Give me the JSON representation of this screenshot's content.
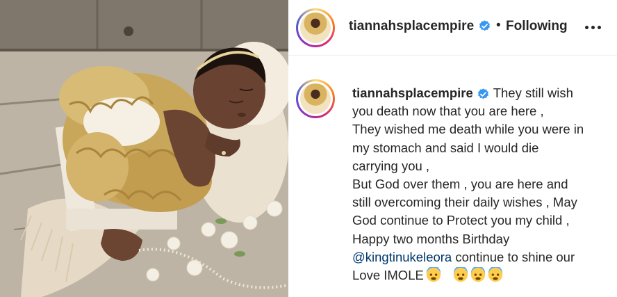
{
  "post": {
    "username": "tiannahsplacempire",
    "verified_icon": "verified-badge-icon",
    "separator": "•",
    "follow_state": "Following",
    "more_icon": "more-options-icon"
  },
  "caption": {
    "author": "tiannahsplacempire",
    "lines": [
      "They still wish",
      "you death now that you are here ,",
      "They wished me death while you were in",
      "my stomach and said I would die",
      "carrying you ,",
      "But God over them , you are here and",
      "still overcoming their daily wishes , May",
      "God continue to Protect you my child ,",
      "Happy two months Birthday"
    ],
    "mention": "@kingtinukeleora",
    "mention_tail": " continue to shine our",
    "last_line": "Love IMOLE",
    "emojis": [
      "fearful-face-emoji",
      "fearful-face-emoji",
      "fearful-face-emoji",
      "fearful-face-emoji"
    ]
  },
  "colors": {
    "verified_blue": "#3897f0",
    "mention_link": "#00376b",
    "text": "#262626"
  }
}
